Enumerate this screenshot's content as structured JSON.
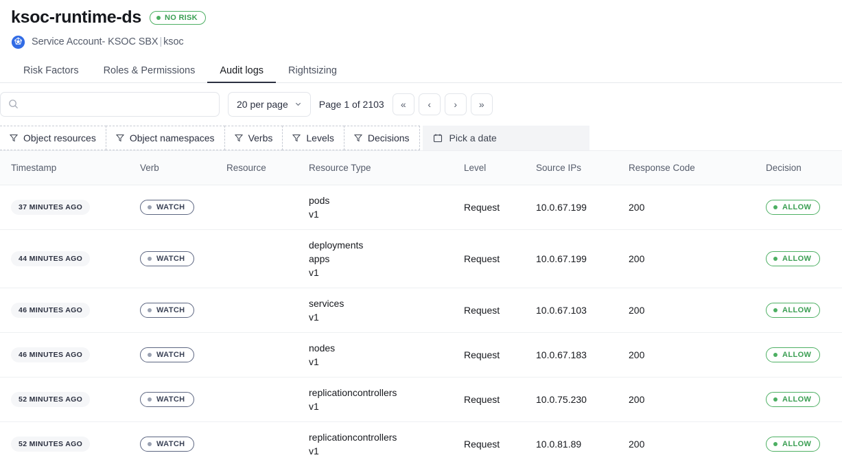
{
  "header": {
    "title": "ksoc-runtime-ds",
    "risk_badge": {
      "label": "NO RISK",
      "color": "#4caf62",
      "icon": "dot-icon"
    },
    "subtitle_icon": "kubernetes-icon",
    "subtitle_main": "Service Account- KSOC SBX",
    "subtitle_sep": "|",
    "subtitle_namespace": "ksoc"
  },
  "tabs": [
    {
      "label": "Risk Factors",
      "active": false
    },
    {
      "label": "Roles & Permissions",
      "active": false
    },
    {
      "label": "Audit logs",
      "active": true
    },
    {
      "label": "Rightsizing",
      "active": false
    }
  ],
  "toolbar": {
    "search": {
      "value": "",
      "placeholder": "",
      "icon": "search-icon"
    },
    "per_page": {
      "label": "20 per page",
      "icon": "chevron-down-icon"
    },
    "page_label": "Page 1 of 2103",
    "pager": [
      {
        "name": "first-page",
        "glyph": "«"
      },
      {
        "name": "prev-page",
        "glyph": "‹"
      },
      {
        "name": "next-page",
        "glyph": "›"
      },
      {
        "name": "last-page",
        "glyph": "»"
      }
    ]
  },
  "filters": [
    {
      "label": "Object resources",
      "icon": "filter-icon"
    },
    {
      "label": "Object namespaces",
      "icon": "filter-icon"
    },
    {
      "label": "Verbs",
      "icon": "filter-icon"
    },
    {
      "label": "Levels",
      "icon": "filter-icon"
    },
    {
      "label": "Decisions",
      "icon": "filter-icon"
    }
  ],
  "date_picker": {
    "label": "Pick a date",
    "icon": "calendar-icon"
  },
  "table": {
    "columns": [
      "Timestamp",
      "Verb",
      "Resource",
      "Resource Type",
      "Level",
      "Source IPs",
      "Response Code",
      "Decision"
    ],
    "rows": [
      {
        "timestamp": "37 MINUTES AGO",
        "verb": "WATCH",
        "resource": "",
        "resource_type": [
          "pods",
          "v1"
        ],
        "level": "Request",
        "source_ip": "10.0.67.199",
        "response_code": "200",
        "decision": "ALLOW"
      },
      {
        "timestamp": "44 MINUTES AGO",
        "verb": "WATCH",
        "resource": "",
        "resource_type": [
          "deployments",
          "apps",
          "v1"
        ],
        "level": "Request",
        "source_ip": "10.0.67.199",
        "response_code": "200",
        "decision": "ALLOW"
      },
      {
        "timestamp": "46 MINUTES AGO",
        "verb": "WATCH",
        "resource": "",
        "resource_type": [
          "services",
          "v1"
        ],
        "level": "Request",
        "source_ip": "10.0.67.103",
        "response_code": "200",
        "decision": "ALLOW"
      },
      {
        "timestamp": "46 MINUTES AGO",
        "verb": "WATCH",
        "resource": "",
        "resource_type": [
          "nodes",
          "v1"
        ],
        "level": "Request",
        "source_ip": "10.0.67.183",
        "response_code": "200",
        "decision": "ALLOW"
      },
      {
        "timestamp": "52 MINUTES AGO",
        "verb": "WATCH",
        "resource": "",
        "resource_type": [
          "replicationcontrollers",
          "v1"
        ],
        "level": "Request",
        "source_ip": "10.0.75.230",
        "response_code": "200",
        "decision": "ALLOW"
      },
      {
        "timestamp": "52 MINUTES AGO",
        "verb": "WATCH",
        "resource": "",
        "resource_type": [
          "replicationcontrollers",
          "v1"
        ],
        "level": "Request",
        "source_ip": "10.0.81.89",
        "response_code": "200",
        "decision": "ALLOW"
      }
    ]
  },
  "colors": {
    "accent_green": "#4caf62",
    "verb_border": "#5b6580",
    "text_primary": "#16181d",
    "text_secondary": "#555c6b",
    "k8s_blue": "#326ce5"
  }
}
